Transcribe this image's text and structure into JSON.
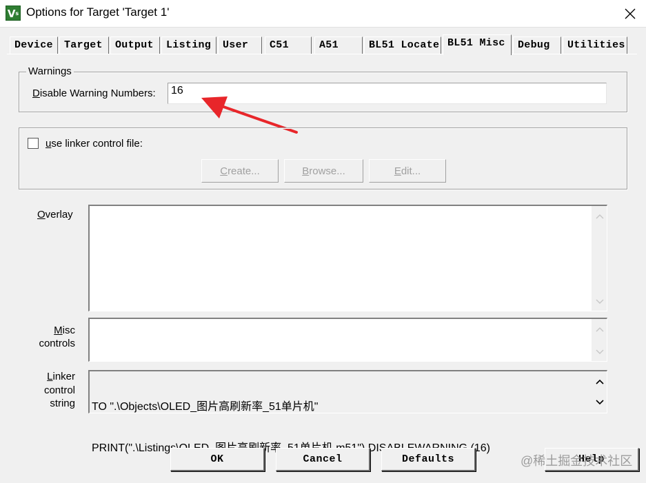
{
  "window": {
    "title": "Options for Target 'Target 1'",
    "app_icon_letter": "V",
    "app_icon_sub": "s"
  },
  "tabs": [
    {
      "label": "Device"
    },
    {
      "label": "Target"
    },
    {
      "label": "Output"
    },
    {
      "label": "Listing"
    },
    {
      "label": "User"
    },
    {
      "label": "C51"
    },
    {
      "label": "A51"
    },
    {
      "label": "BL51 Locate"
    },
    {
      "label": "BL51 Misc",
      "active": true
    },
    {
      "label": "Debug"
    },
    {
      "label": "Utilities"
    }
  ],
  "warnings": {
    "group_label": "Warnings",
    "disable_label_pre": "",
    "disable_label_hot": "D",
    "disable_label_post": "isable Warning Numbers:",
    "disable_value": "16"
  },
  "linker_control_file": {
    "checkbox_label_pre": "",
    "checkbox_label_hot": "u",
    "checkbox_label_post": "se linker control file:",
    "checked": false,
    "create_hot": "C",
    "create_rest": "reate...",
    "browse_hot": "B",
    "browse_rest": "rowse...",
    "edit_hot": "E",
    "edit_rest": "dit..."
  },
  "overlay": {
    "label_hot": "O",
    "label_rest": "verlay",
    "value": ""
  },
  "misc_controls": {
    "label_line1_hot": "M",
    "label_line1_rest": "isc",
    "label_line2": "controls",
    "value": ""
  },
  "linker_control_string": {
    "label_line1_hot": "L",
    "label_line1_rest": "inker",
    "label_line2": "control",
    "label_line3": "string",
    "line1": "TO \".\\Objects\\OLED_图片高刷新率_51单片机\"",
    "line2": "PRINT(\".\\Listings\\OLED_图片高刷新率_51单片机.m51\") DISABLEWARNING (16)"
  },
  "buttons": {
    "ok": "OK",
    "cancel": "Cancel",
    "defaults": "Defaults",
    "help": "Help"
  },
  "watermark": "@稀土掘金技术社区",
  "colors": {
    "arrow": "#e8262a",
    "dialog_bg": "#f0f0f0",
    "disabled_text": "#a0a0a0"
  }
}
